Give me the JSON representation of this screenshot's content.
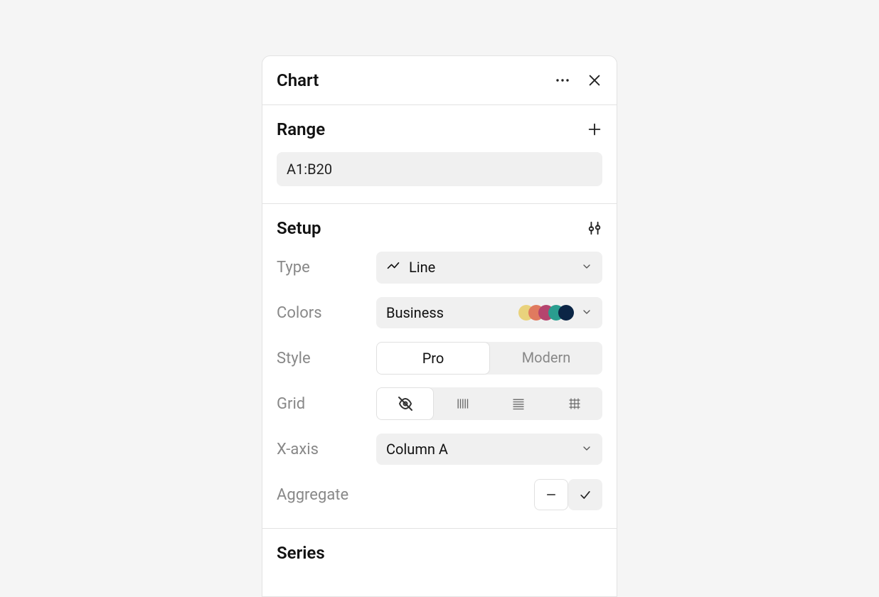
{
  "header": {
    "title": "Chart"
  },
  "range": {
    "title": "Range",
    "value": "A1:B20"
  },
  "setup": {
    "title": "Setup",
    "type": {
      "label": "Type",
      "value": "Line"
    },
    "colors": {
      "label": "Colors",
      "value": "Business",
      "swatches": [
        "#e9d27c",
        "#e07a5f",
        "#b5446e",
        "#2a9d8f",
        "#0b2545"
      ]
    },
    "style": {
      "label": "Style",
      "options": [
        "Pro",
        "Modern"
      ],
      "selected": "Pro"
    },
    "grid": {
      "label": "Grid",
      "selected": 0
    },
    "xaxis": {
      "label": "X-axis",
      "value": "Column A"
    },
    "aggregate": {
      "label": "Aggregate",
      "selected": "none"
    }
  },
  "series": {
    "title": "Series"
  }
}
